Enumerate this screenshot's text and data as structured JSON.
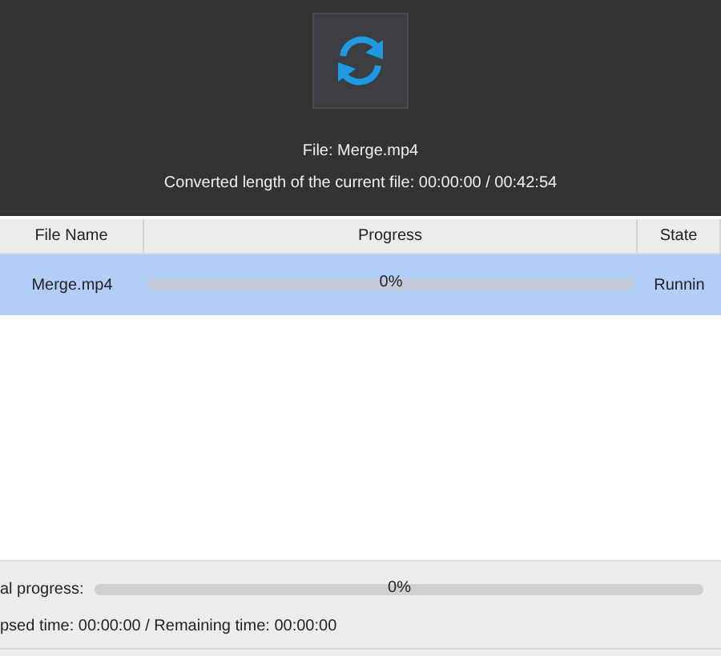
{
  "header": {
    "file_label": "File: Merge.mp4",
    "converted_length": "Converted length of the current file: 00:00:00 / 00:42:54"
  },
  "table": {
    "columns": [
      "File Name",
      "Progress",
      "State"
    ],
    "rows": [
      {
        "file_name": "Merge.mp4",
        "progress": {
          "level": 0,
          "text": "0%"
        },
        "state": "Runnin",
        "selected": true
      }
    ]
  },
  "footer": {
    "total_label": "al progress:",
    "total_progress": {
      "level": 0,
      "text": "0%"
    },
    "times": "psed time: 00:00:00 / Remaining time: 00:00:00"
  }
}
